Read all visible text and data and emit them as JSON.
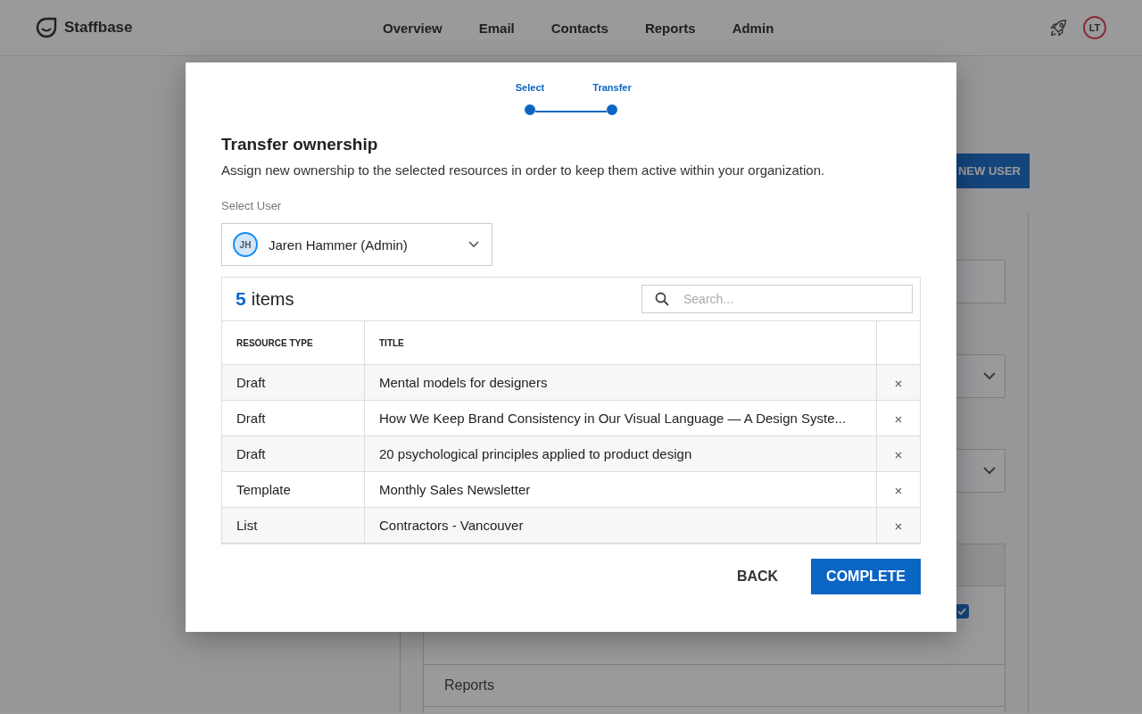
{
  "header": {
    "brand": "Staffbase",
    "nav": [
      "Overview",
      "Email",
      "Contacts",
      "Reports",
      "Admin"
    ],
    "avatar": "LT"
  },
  "background": {
    "new_user_button": "NEW USER",
    "permission_checked": true,
    "sections": [
      "Reports"
    ]
  },
  "modal": {
    "steps": [
      {
        "label": "Select",
        "completed": true
      },
      {
        "label": "Transfer",
        "completed": true
      }
    ],
    "title": "Transfer ownership",
    "description": "Assign new ownership to the selected resources in order to keep them active within your organization.",
    "select_user": {
      "label": "Select User",
      "initials": "JH",
      "value": "Jaren Hammer (Admin)"
    },
    "table": {
      "count": "5",
      "count_label": "items",
      "search": {
        "placeholder": "Search..."
      },
      "columns": [
        "RESOURCE TYPE",
        "TITLE"
      ],
      "rows": [
        {
          "type": "Draft",
          "title": "Mental models for designers"
        },
        {
          "type": "Draft",
          "title": "How We Keep Brand Consistency in Our Visual Language — A Design Syste..."
        },
        {
          "type": "Draft",
          "title": "20 psychological principles applied to product design"
        },
        {
          "type": "Template",
          "title": "Monthly Sales Newsletter"
        },
        {
          "type": "List",
          "title": "Contractors - Vancouver"
        }
      ]
    },
    "buttons": {
      "back": "BACK",
      "complete": "COMPLETE"
    }
  }
}
